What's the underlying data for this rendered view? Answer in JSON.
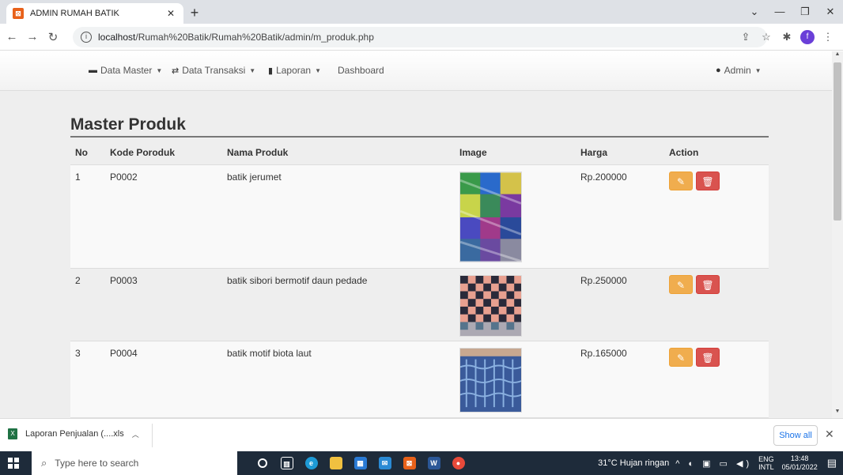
{
  "browser": {
    "tab_title": "ADMIN RUMAH BATIK",
    "url_host": "localhost",
    "url_path": "/Rumah%20Batik/Rumah%20Batik/admin/m_produk.php",
    "profile_letter": "f"
  },
  "navbar": {
    "items": [
      {
        "label": "Data Master",
        "icon": "briefcase-icon",
        "dropdown": true
      },
      {
        "label": "Data Transaksi",
        "icon": "transfer-icon",
        "dropdown": true
      },
      {
        "label": "Laporan",
        "icon": "stats-icon",
        "dropdown": true
      },
      {
        "label": "Dashboard",
        "icon": "",
        "dropdown": false
      }
    ],
    "user_label": "Admin"
  },
  "page": {
    "title": "Master Produk",
    "columns": [
      "No",
      "Kode Poroduk",
      "Nama Produk",
      "Image",
      "Harga",
      "Action"
    ],
    "rows": [
      {
        "no": "1",
        "kode": "P0002",
        "nama": "batik jerumet",
        "harga": "Rp.200000",
        "image": "patchwork-batik"
      },
      {
        "no": "2",
        "kode": "P0003",
        "nama": "batik sibori bermotif daun pedade",
        "harga": "Rp.250000",
        "image": "checkered-batik"
      },
      {
        "no": "3",
        "kode": "P0004",
        "nama": "batik motif biota laut",
        "harga": "Rp.165000",
        "image": "blue-batik"
      }
    ]
  },
  "downloads": {
    "file_label": "Laporan Penjualan (....xls",
    "show_all": "Show all"
  },
  "taskbar": {
    "search_placeholder": "Type here to search",
    "weather": "31°C  Hujan ringan",
    "lang_top": "ENG",
    "lang_bottom": "INTL",
    "time": "13:48",
    "date": "05/01/2022"
  },
  "colors": {
    "edit_button": "#f0ad4e",
    "delete_button": "#d9534f",
    "page_band": "#eeeeee"
  }
}
